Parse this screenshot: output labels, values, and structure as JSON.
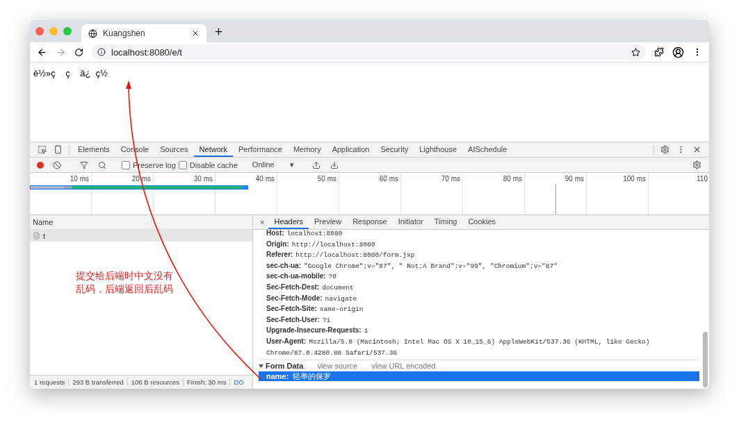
{
  "browser": {
    "tab_title": "Kuangshen",
    "url": "localhost:8080/e/t"
  },
  "page": {
    "text": "è½»ç    ç    ä¿  ç½"
  },
  "devtools": {
    "tabs": [
      {
        "label": "Elements",
        "selected": false
      },
      {
        "label": "Console",
        "selected": false
      },
      {
        "label": "Sources",
        "selected": false
      },
      {
        "label": "Network",
        "selected": true
      },
      {
        "label": "Performance",
        "selected": false
      },
      {
        "label": "Memory",
        "selected": false
      },
      {
        "label": "Application",
        "selected": false
      },
      {
        "label": "Security",
        "selected": false
      },
      {
        "label": "Lighthouse",
        "selected": false
      },
      {
        "label": "AISchedule",
        "selected": false
      }
    ],
    "toolbar": {
      "recording": true,
      "checkboxes": [
        {
          "label": "Preserve log",
          "checked": false
        },
        {
          "label": "Disable cache",
          "checked": false
        }
      ],
      "throttle": "Online",
      "throttle_caret": "▾"
    },
    "timeline": {
      "ticks": [
        "10 ms",
        "20 ms",
        "30 ms",
        "40 ms",
        "50 ms",
        "60 ms",
        "70 ms",
        "80 ms",
        "90 ms",
        "100 ms",
        "110"
      ]
    },
    "requests": {
      "column": "Name",
      "rows": [
        {
          "name": "t",
          "selected": true
        }
      ]
    },
    "detail_tabs": [
      {
        "label": "Headers",
        "selected": true
      },
      {
        "label": "Preview",
        "selected": false
      },
      {
        "label": "Response",
        "selected": false
      },
      {
        "label": "Initiator",
        "selected": false
      },
      {
        "label": "Timing",
        "selected": false
      },
      {
        "label": "Cookies",
        "selected": false
      }
    ],
    "close_symbol": "×",
    "headers": [
      {
        "key": "Host:",
        "value": "localhost:8080"
      },
      {
        "key": "Origin:",
        "value": "http://localhost:8080"
      },
      {
        "key": "Referer:",
        "value": "http://localhost:8080/form.jsp"
      },
      {
        "key": "sec-ch-ua:",
        "value": "\"Google Chrome\";v=\"87\", \" Not;A Brand\";v=\"99\", \"Chromium\";v=\"87\""
      },
      {
        "key": "sec-ch-ua-mobile:",
        "value": "?0"
      },
      {
        "key": "Sec-Fetch-Dest:",
        "value": "document"
      },
      {
        "key": "Sec-Fetch-Mode:",
        "value": "navigate"
      },
      {
        "key": "Sec-Fetch-Site:",
        "value": "same-origin"
      },
      {
        "key": "Sec-Fetch-User:",
        "value": "?1"
      },
      {
        "key": "Upgrade-Insecure-Requests:",
        "value": "1"
      },
      {
        "key": "User-Agent:",
        "value": "Mozilla/5.0 (Macintosh; Intel Mac OS X 10_15_6) AppleWebKit/537.36 (KHTML, like Gecko) Chrome/87.0.4280.88 Safari/537.36"
      }
    ],
    "form_data": {
      "title": "Form Data",
      "expanded": true,
      "links": [
        "view source",
        "view URL encoded"
      ],
      "rows": [
        {
          "key": "name:",
          "value": "轻率的保罗",
          "selected": true
        }
      ]
    },
    "status": [
      "1 requests",
      "293 B transferred",
      "106 B resources",
      "Finish: 30 ms",
      "DO"
    ]
  },
  "annotation": {
    "text": "提交给后端时中文没有乱码，后端返回后乱码"
  }
}
